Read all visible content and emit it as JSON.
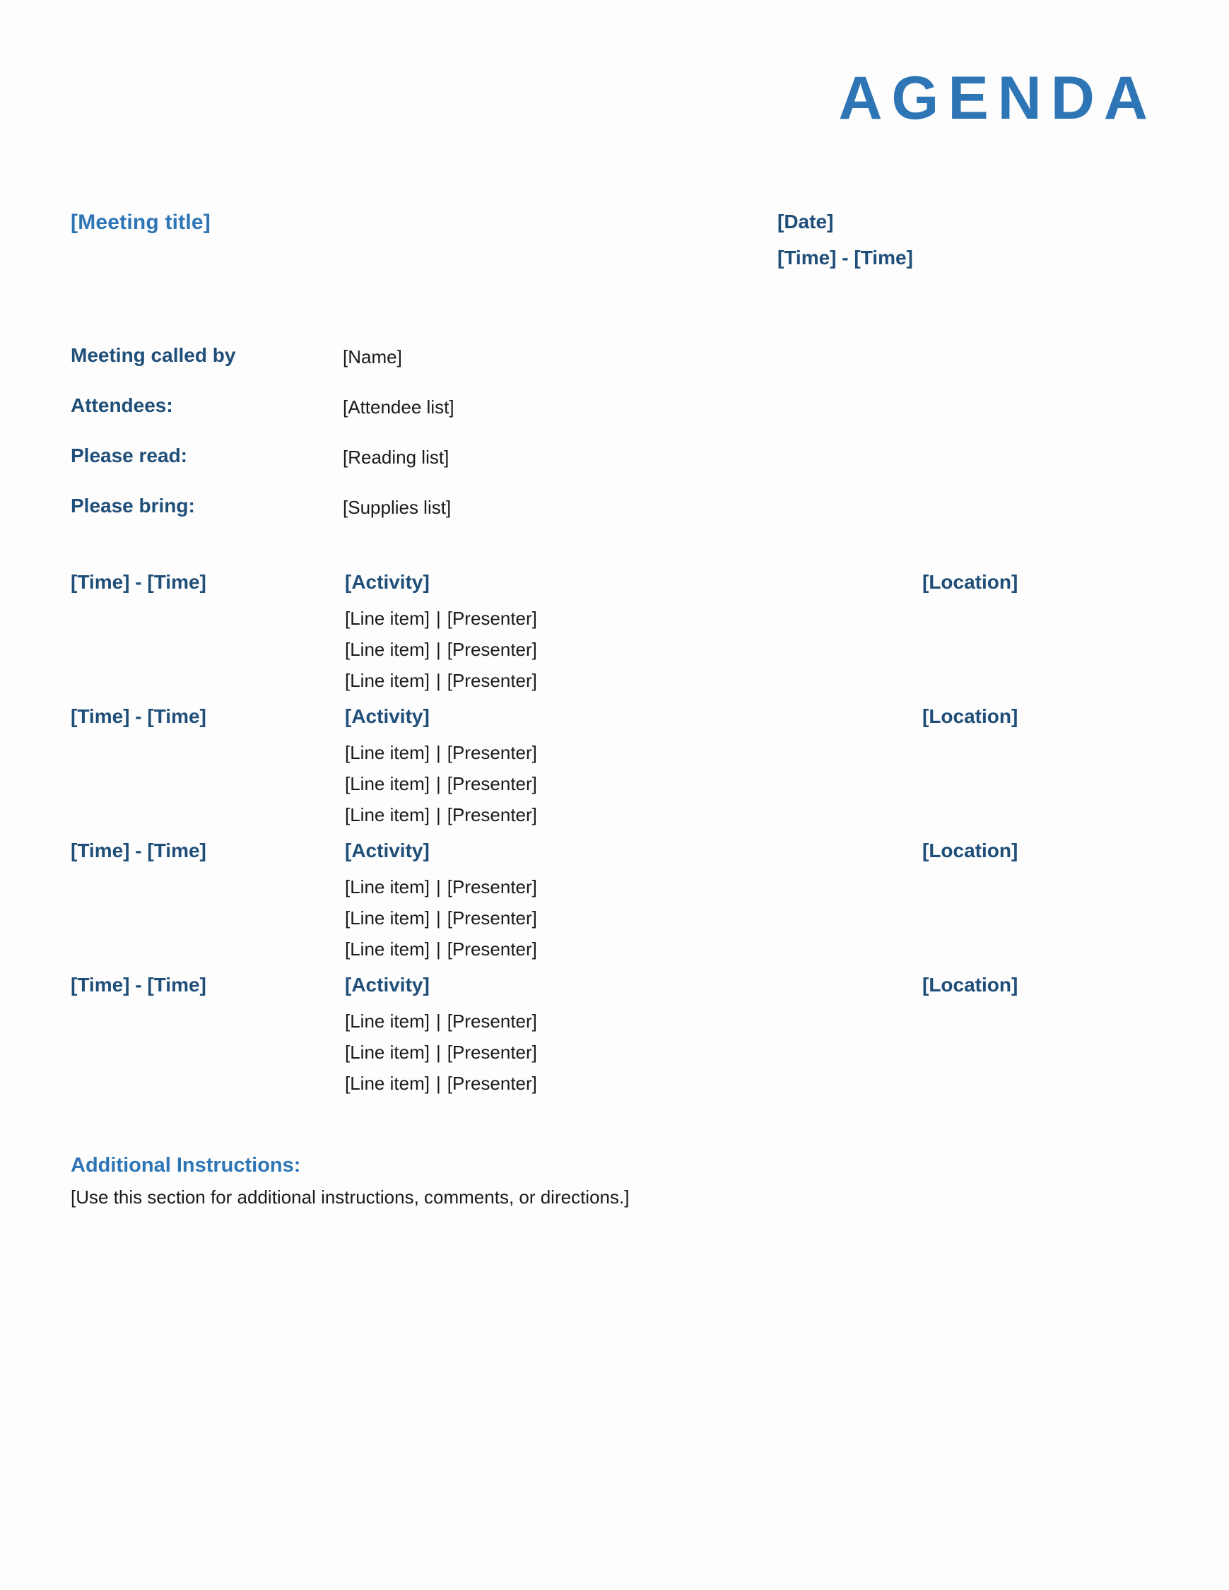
{
  "document": {
    "title": "AGENDA",
    "meeting_title": "[Meeting title]",
    "date": "[Date]",
    "time_range": "[Time] - [Time]"
  },
  "colors": {
    "accent_blue": "#2E75B6",
    "navy": "#1F4E79",
    "body_text": "#1A1A1A",
    "page_background": "#FDFDFD"
  },
  "info": {
    "rows": [
      {
        "label": "Meeting called by",
        "value": "[Name]"
      },
      {
        "label": "Attendees:",
        "value": "[Attendee list]"
      },
      {
        "label": "Please read:",
        "value": "[Reading list]"
      },
      {
        "label": "Please bring:",
        "value": "[Supplies list]"
      }
    ]
  },
  "agenda": {
    "separator": "|",
    "rows": [
      {
        "time": "[Time] - [Time]",
        "activity": "[Activity]",
        "location": "[Location]",
        "items": [
          {
            "line_item": "[Line item]",
            "presenter": "[Presenter]"
          },
          {
            "line_item": "[Line item]",
            "presenter": "[Presenter]"
          },
          {
            "line_item": "[Line item]",
            "presenter": "[Presenter]"
          }
        ]
      },
      {
        "time": "[Time] - [Time]",
        "activity": "[Activity]",
        "location": "[Location]",
        "items": [
          {
            "line_item": "[Line item]",
            "presenter": "[Presenter]"
          },
          {
            "line_item": "[Line item]",
            "presenter": "[Presenter]"
          },
          {
            "line_item": "[Line item]",
            "presenter": "[Presenter]"
          }
        ]
      },
      {
        "time": "[Time] - [Time]",
        "activity": "[Activity]",
        "location": "[Location]",
        "items": [
          {
            "line_item": "[Line item]",
            "presenter": "[Presenter]"
          },
          {
            "line_item": "[Line item]",
            "presenter": "[Presenter]"
          },
          {
            "line_item": "[Line item]",
            "presenter": "[Presenter]"
          }
        ]
      },
      {
        "time": "[Time] - [Time]",
        "activity": "[Activity]",
        "location": "[Location]",
        "items": [
          {
            "line_item": "[Line item]",
            "presenter": "[Presenter]"
          },
          {
            "line_item": "[Line item]",
            "presenter": "[Presenter]"
          },
          {
            "line_item": "[Line item]",
            "presenter": "[Presenter]"
          }
        ]
      }
    ]
  },
  "additional_instructions": {
    "heading": "Additional Instructions:",
    "body": "[Use this section for additional instructions, comments, or directions.]"
  }
}
